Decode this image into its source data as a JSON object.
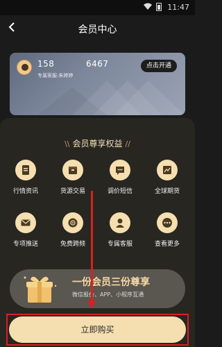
{
  "status": {
    "time": "11:47"
  },
  "header": {
    "title": "会员中心"
  },
  "card": {
    "phone_prefix": "158",
    "phone_suffix": "6467",
    "service": "专属客服:朱婷婷",
    "open_label": "点击开通"
  },
  "section": {
    "title": "会员尊享权益"
  },
  "benefits": [
    {
      "label": "行情资讯",
      "icon": "document-icon"
    },
    {
      "label": "货源交易",
      "icon": "cargo-box-icon"
    },
    {
      "label": "调价短信",
      "icon": "message-icon"
    },
    {
      "label": "全球期货",
      "icon": "chart-icon"
    },
    {
      "label": "专项推送",
      "icon": "mail-icon"
    },
    {
      "label": "免费跨频",
      "icon": "globe-icon"
    },
    {
      "label": "专属客服",
      "icon": "service-icon"
    },
    {
      "label": "查看更多",
      "icon": "more-icon"
    }
  ],
  "promo": {
    "title": "一份会员三份尊享",
    "subtitle": "微信报价、APP、小程序互通"
  },
  "buy": {
    "label": "立即购买"
  },
  "colors": {
    "accent": "#f5dfb0",
    "highlight": "#d92020",
    "background": "#272621"
  }
}
